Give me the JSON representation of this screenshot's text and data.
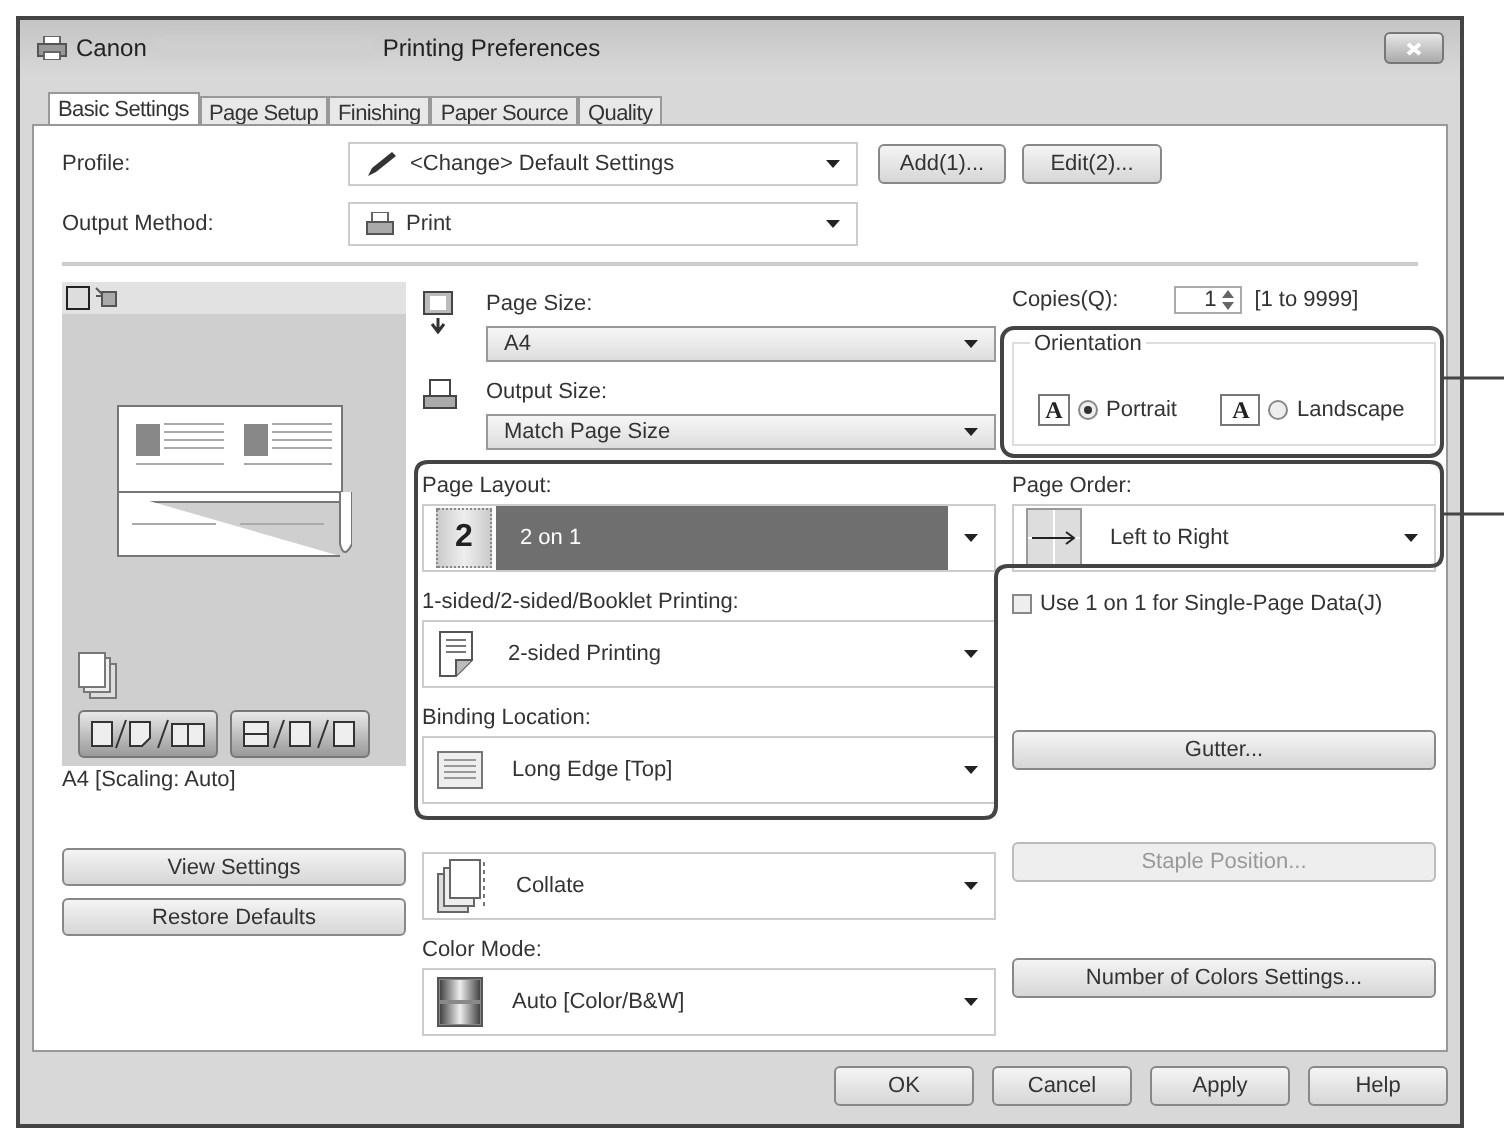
{
  "window": {
    "title_start": "Canon",
    "title_end": "Printing Preferences"
  },
  "tabs": [
    {
      "label": "Basic Settings",
      "selected": true
    },
    {
      "label": "Page Setup",
      "selected": false
    },
    {
      "label": "Finishing",
      "selected": false
    },
    {
      "label": "Paper Source",
      "selected": false
    },
    {
      "label": "Quality",
      "selected": false
    }
  ],
  "profile": {
    "label": "Profile:",
    "value": "<Change> Default Settings",
    "buttons": [
      "Add(1)...",
      "Edit(2)..."
    ]
  },
  "output_method": {
    "label": "Output Method:",
    "value": "Print"
  },
  "preview": {
    "caption": "A4 [Scaling: Auto]"
  },
  "left_buttons": [
    "View Settings",
    "Restore Defaults"
  ],
  "page_size": {
    "label": "Page Size:",
    "value": "A4"
  },
  "output_size": {
    "label": "Output Size:",
    "value": "Match Page Size"
  },
  "sections": [
    {
      "kind": "layout",
      "label": "Page Layout:",
      "value": "2 on 1",
      "icon_text": "2",
      "focused": true
    },
    {
      "kind": "duplex",
      "label": "1-sided/2-sided/Booklet Printing:",
      "value": "2-sided Printing",
      "focused": false
    },
    {
      "kind": "binding",
      "label": "Binding Location:",
      "value": "Long Edge [Top]",
      "focused": false
    },
    {
      "kind": "collate",
      "value": "Collate",
      "focused": false
    },
    {
      "kind": "color",
      "label": "Color Mode:",
      "value": "Auto [Color/B&W]",
      "focused": false
    }
  ],
  "copies": {
    "label": "Copies(Q):",
    "value": "1",
    "range": "[1 to 9999]"
  },
  "orientation": {
    "title": "Orientation",
    "options": [
      {
        "label": "Portrait",
        "icon_text": "A",
        "selected": true
      },
      {
        "label": "Landscape",
        "icon_text": "A",
        "selected": false
      }
    ]
  },
  "page_order": {
    "label": "Page Order:",
    "value": "Left to Right"
  },
  "single_page": {
    "label": "Use 1 on 1 for Single-Page Data(J)",
    "checked": false
  },
  "right_buttons": [
    {
      "label": "Gutter...",
      "disabled": false
    },
    {
      "label": "Staple Position...",
      "disabled": true
    },
    {
      "label": "Number of Colors Settings...",
      "disabled": false
    }
  ],
  "footer_buttons": [
    "OK",
    "Cancel",
    "Apply",
    "Help"
  ]
}
